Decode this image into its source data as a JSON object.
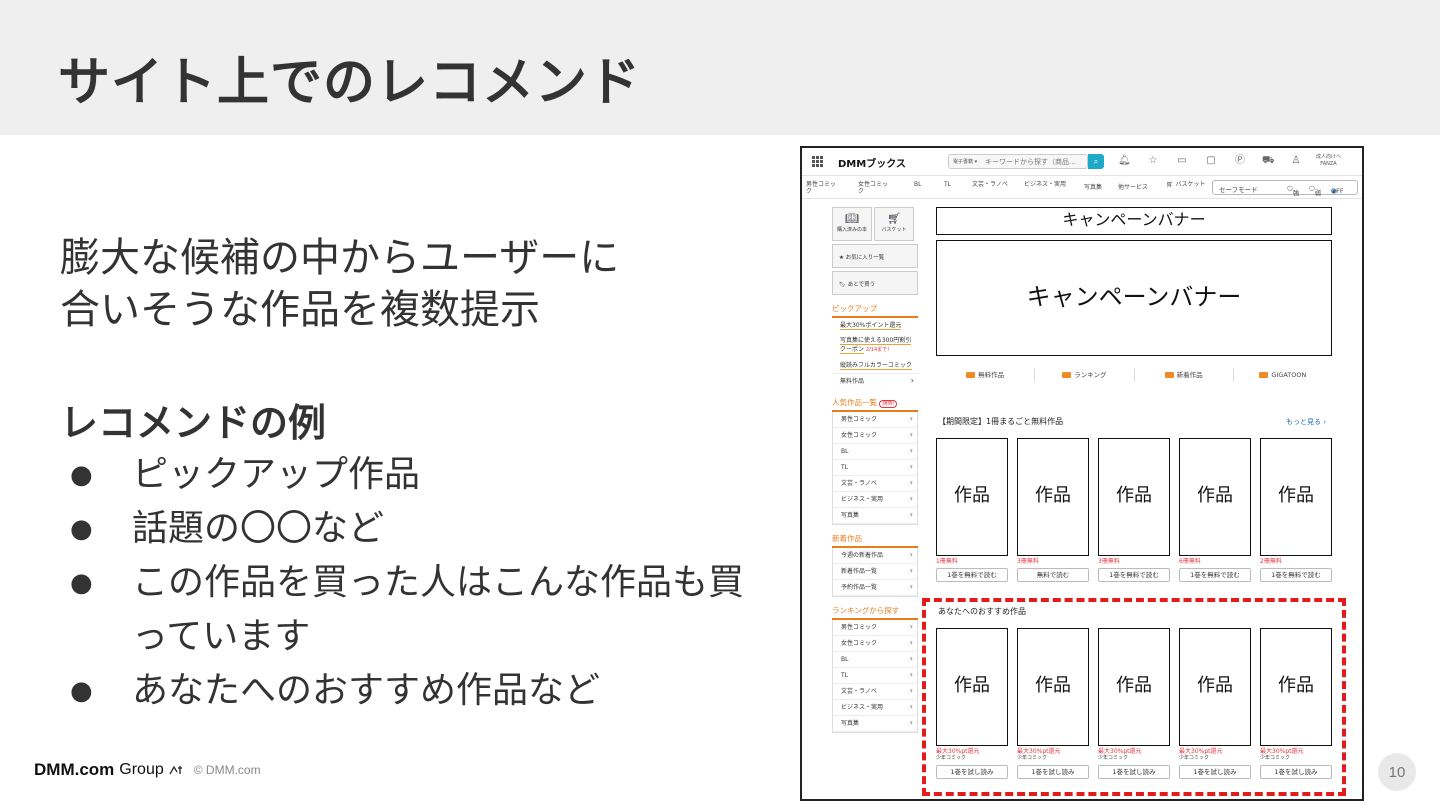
{
  "slide": {
    "title": "サイト上でのレコメンド",
    "lead_line1": "膨大な候補の中からユーザーに",
    "lead_line2": "合いそうな作品を複数提示",
    "sub_heading": "レコメンドの例",
    "bullets": [
      "ピックアップ作品",
      "話題の〇〇など",
      "この作品を買った人はこんな作品も買っています",
      "あなたへのおすすめ作品など"
    ],
    "bullet_symbol": "●",
    "footer_brand": "DMM.com",
    "footer_group": "Group",
    "footer_copyright": "© DMM.com",
    "page_number": "10"
  },
  "mock_site": {
    "logo": "DMMブックス",
    "search_category": "電子書籍 ▾",
    "search_placeholder": "キーワードから探す（商品…",
    "header_icons": [
      "grid-icon",
      "search-icon",
      "bell-icon",
      "star-icon",
      "library-icon",
      "chat-icon",
      "point-icon",
      "cart-icon",
      "user-icon"
    ],
    "adult_link_line1": "成人向けへ",
    "adult_link_line2": "FANZA",
    "nav": [
      "男性コミック",
      "女性コミック",
      "BL",
      "TL",
      "文芸・ラノベ",
      "ビジネス・実用",
      "写真集",
      "他サービス",
      "バスケット"
    ],
    "safe_mode": {
      "label": "セーフモード",
      "options": [
        "強",
        "弱",
        "OFF"
      ],
      "selected": "OFF"
    },
    "sidebar": {
      "shortcuts": [
        "購入済みの本",
        "バスケット"
      ],
      "favorites": "お気に入り一覧",
      "later": "あとで買う",
      "pickup_title": "ピックアップ",
      "pickup_items": [
        "最大30%ポイント還元",
        "写真集に使える300円割引クーポン",
        "縦読みフルカラーコミック",
        "無料作品"
      ],
      "pickup_coupon_date": "2/14まで！",
      "popular_title": "人気作品一覧",
      "popular_badge": "随時!",
      "popular_items": [
        "男性コミック",
        "女性コミック",
        "BL",
        "TL",
        "文芸・ラノベ",
        "ビジネス・実用",
        "写真集"
      ],
      "new_title": "新着作品",
      "new_items": [
        "今週の新着作品",
        "新着作品一覧",
        "予約作品一覧"
      ],
      "ranking_title": "ランキングから探す",
      "ranking_items": [
        "男性コミック",
        "女性コミック",
        "BL",
        "TL",
        "文芸・ラノベ",
        "ビジネス・実用",
        "写真集"
      ]
    },
    "banner_small": "キャンペーンバナー",
    "banner_large": "キャンペーンバナー",
    "quick_links": [
      "無料作品",
      "ランキング",
      "新着作品",
      "GIGATOON"
    ],
    "free_section": {
      "title": "【期間限定】1冊まるごと無料作品",
      "more": "もっと見る ›",
      "items": [
        {
          "cover": "作品",
          "badge": "1冊無料",
          "button": "1巻を無料で読む"
        },
        {
          "cover": "作品",
          "badge": "3冊無料",
          "button": "無料で読む"
        },
        {
          "cover": "作品",
          "badge": "3冊無料",
          "button": "1巻を無料で読む"
        },
        {
          "cover": "作品",
          "badge": "6冊無料",
          "button": "1巻を無料で読む"
        },
        {
          "cover": "作品",
          "badge": "2冊無料",
          "button": "1巻を無料で読む"
        }
      ]
    },
    "recommend_section": {
      "title": "あなたへのおすすめ作品",
      "items": [
        {
          "cover": "作品",
          "badge": "最大30%pt還元",
          "genre": "少年コミック",
          "button": "1巻を試し読み"
        },
        {
          "cover": "作品",
          "badge": "最大30%pt還元",
          "genre": "少年コミック",
          "button": "1巻を試し読み"
        },
        {
          "cover": "作品",
          "badge": "最大30%pt還元",
          "genre": "少年コミック",
          "button": "1巻を試し読み"
        },
        {
          "cover": "作品",
          "badge": "最大30%pt還元",
          "genre": "少年コミック",
          "button": "1巻を試し読み"
        },
        {
          "cover": "作品",
          "badge": "最大30%pt還元",
          "genre": "少年コミック",
          "button": "1巻を試し読み"
        }
      ]
    }
  },
  "colors": {
    "title_bar": "#efefef",
    "accent_orange": "#e87d1e",
    "highlight_red": "#e21b1b",
    "price_red": "#e2343f",
    "search_button": "#1ea9c8"
  }
}
